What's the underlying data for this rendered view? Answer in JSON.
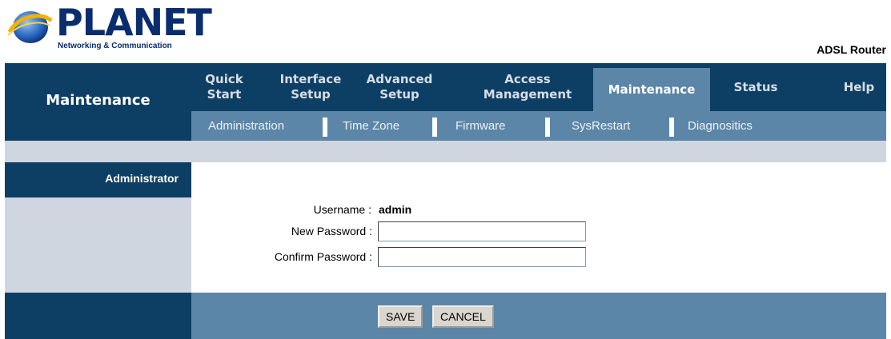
{
  "brand": {
    "name": "PLANET",
    "tagline": "Networking & Communication",
    "product": "ADSL Router"
  },
  "nav": {
    "section_title": "Maintenance",
    "tabs": [
      {
        "line1": "Quick",
        "line2": "Start"
      },
      {
        "line1": "Interface",
        "line2": "Setup"
      },
      {
        "line1": "Advanced",
        "line2": "Setup"
      },
      {
        "line1": "Access",
        "line2": "Management"
      },
      {
        "line1": "Maintenance",
        "line2": "",
        "active": true
      },
      {
        "line1": "Status",
        "line2": ""
      },
      {
        "line1": "Help",
        "line2": ""
      }
    ],
    "subtabs": [
      "Administration",
      "Time Zone",
      "Firmware",
      "SysRestart",
      "Diagnositics"
    ],
    "active_subtab": "Administration"
  },
  "panel": {
    "heading": "Administrator",
    "username_label": "Username :",
    "username_value": "admin",
    "new_password_label": "New Password :",
    "new_password_value": "",
    "confirm_password_label": "Confirm Password :",
    "confirm_password_value": ""
  },
  "actions": {
    "save_label": "SAVE",
    "cancel_label": "CANCEL"
  },
  "colors": {
    "nav_dark": "#0d3f64",
    "nav_mid": "#5b86a8",
    "band": "#cfd6df"
  }
}
